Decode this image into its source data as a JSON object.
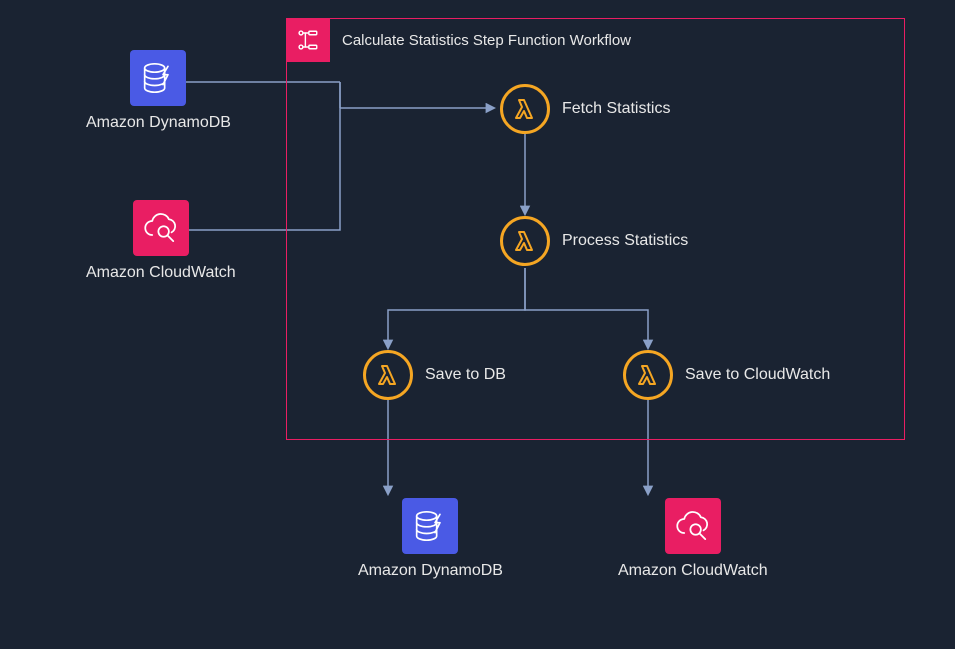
{
  "workflow": {
    "title": "Calculate Statistics Step Function Workflow"
  },
  "nodes": {
    "dynamodb_left": "Amazon DynamoDB",
    "cloudwatch_left": "Amazon CloudWatch",
    "fetch": "Fetch Statistics",
    "process": "Process Statistics",
    "save_db": "Save to DB",
    "save_cw": "Save to CloudWatch",
    "dynamodb_bottom": "Amazon DynamoDB",
    "cloudwatch_bottom": "Amazon CloudWatch"
  }
}
